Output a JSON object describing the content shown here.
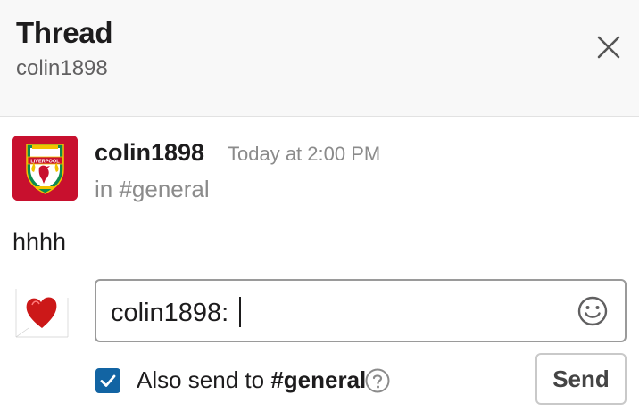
{
  "header": {
    "title": "Thread",
    "subtitle": "colin1898",
    "close_icon": "close-icon"
  },
  "message": {
    "author": "colin1898",
    "timestamp": "Today at 2:00 PM",
    "channel_prefix": "in ",
    "channel": "#general",
    "body": "hhhh",
    "avatar_icon": "liverpool-crest-icon",
    "avatar_text": "LIVERPOOL"
  },
  "reply": {
    "avatar_icon": "heart-avatar-icon",
    "input_value": "colin1898: ",
    "emoji_icon": "smiley-icon"
  },
  "footer": {
    "also_send_checked": true,
    "also_send_prefix": "Also send to ",
    "also_send_channel": "#general",
    "help_icon": "help-icon",
    "send_label": "Send"
  },
  "colors": {
    "accent": "#1264a3",
    "crest_red": "#c8102e",
    "header_bg": "#f8f8f8"
  }
}
